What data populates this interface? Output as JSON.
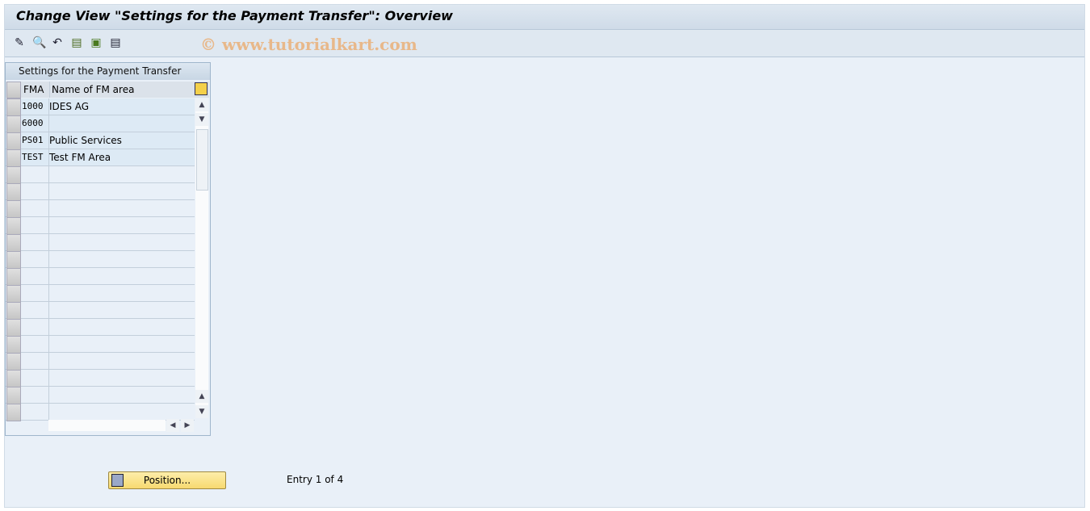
{
  "window": {
    "title": "Change View \"Settings for the Payment Transfer\": Overview"
  },
  "toolbar": {
    "icons": [
      "pencil-glasses-icon",
      "find-icon",
      "undo-icon",
      "select-all-icon",
      "select-block-icon",
      "deselect-all-icon"
    ],
    "watermark": "© www.tutorialkart.com"
  },
  "table": {
    "title": "Settings for the Payment Transfer",
    "columns": [
      "FMA",
      "Name of FM area"
    ],
    "rows": [
      {
        "fma": "1000",
        "name": "IDES AG"
      },
      {
        "fma": "6000",
        "name": ""
      },
      {
        "fma": "PS01",
        "name": "Public Services"
      },
      {
        "fma": "TEST",
        "name": "Test FM Area"
      }
    ],
    "empty_rows": 15
  },
  "footer": {
    "position_label": "Position...",
    "entry_text": "Entry 1 of 4"
  }
}
